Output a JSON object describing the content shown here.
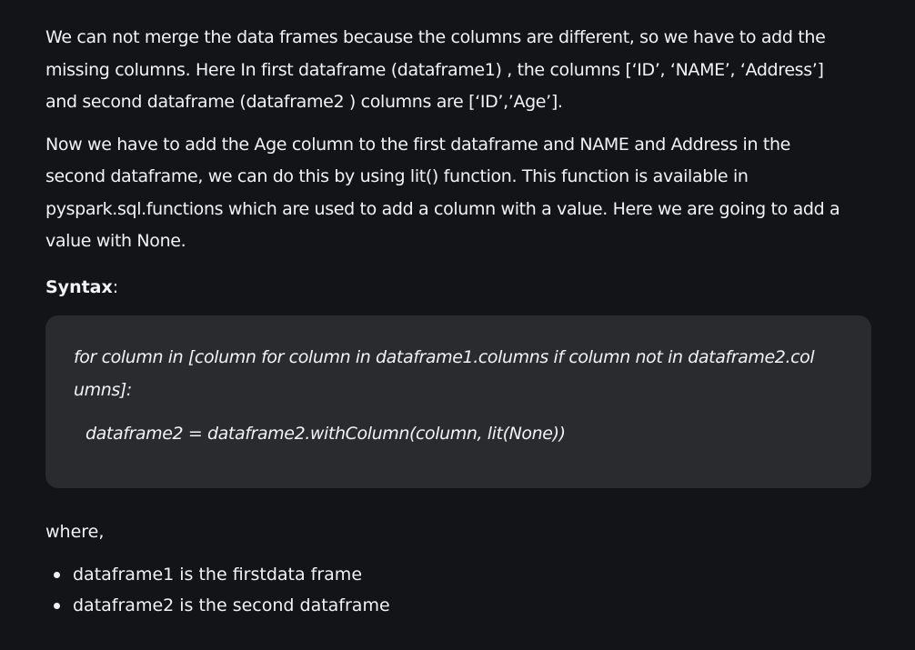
{
  "intro": {
    "line1": "We can not merge the data frames because the columns are different, so we have to add the",
    "line2": "missing columns. Here In first dataframe (dataframe1) , the columns  [‘ID’, ‘NAME’, ‘Address’]",
    "line3": "and second dataframe (dataframe2 ) columns are  [‘ID’,’Age’]."
  },
  "explanation": {
    "line1": "Now we have to add the Age column to the first dataframe and NAME and Address in the",
    "line2": "second dataframe, we can do this by using lit() function. This function is available in",
    "line3": "pyspark.sql.functions which are used to add a column with a value. Here we are going to add a",
    "line4": "value with None."
  },
  "syntax": {
    "label": "Syntax",
    "colon": ":",
    "code_line1a": "for column in [column for column in dataframe1.columns if column not in dataframe2.col",
    "code_line1b": "umns]:",
    "code_line2": "dataframe2 = dataframe2.withColumn(column, lit(None))"
  },
  "where_label": "where,",
  "bullets": [
    "dataframe1 is the firstdata frame",
    "dataframe2 is the second dataframe"
  ]
}
